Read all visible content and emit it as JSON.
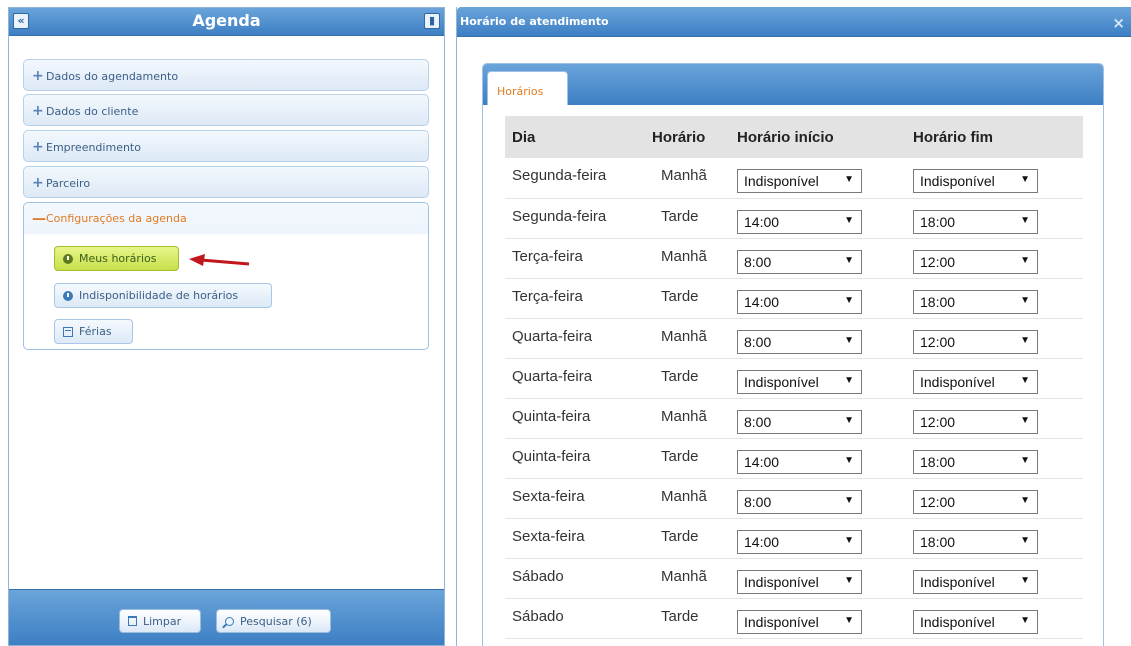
{
  "left": {
    "title": "Agenda",
    "collapse_icon": "«",
    "pin_icon": "▮",
    "accordion": [
      {
        "sign": "+",
        "label": "Dados do agendamento"
      },
      {
        "sign": "+",
        "label": "Dados do cliente"
      },
      {
        "sign": "+",
        "label": "Empreendimento"
      },
      {
        "sign": "+",
        "label": "Parceiro"
      },
      {
        "sign": "—",
        "label": "Configurações da agenda"
      }
    ],
    "sub_buttons": {
      "meus_horarios": "Meus horários",
      "indisponibilidade": "Indisponibilidade de horários",
      "ferias": "Férias"
    },
    "footer": {
      "limpar": "Limpar",
      "pesquisar": "Pesquisar (6)"
    }
  },
  "right": {
    "title": "Horário de atendimento",
    "close_icon": "×",
    "tab": "Horários",
    "columns": [
      "Dia",
      "Horário",
      "Horário início",
      "Horário fim"
    ],
    "rows": [
      {
        "dia": "Segunda-feira",
        "horario": "Manhã",
        "inicio": "Indisponível",
        "fim": "Indisponível"
      },
      {
        "dia": "Segunda-feira",
        "horario": "Tarde",
        "inicio": "14:00",
        "fim": "18:00"
      },
      {
        "dia": "Terça-feira",
        "horario": "Manhã",
        "inicio": "8:00",
        "fim": "12:00"
      },
      {
        "dia": "Terça-feira",
        "horario": "Tarde",
        "inicio": "14:00",
        "fim": "18:00"
      },
      {
        "dia": "Quarta-feira",
        "horario": "Manhã",
        "inicio": "8:00",
        "fim": "12:00"
      },
      {
        "dia": "Quarta-feira",
        "horario": "Tarde",
        "inicio": "Indisponível",
        "fim": "Indisponível"
      },
      {
        "dia": "Quinta-feira",
        "horario": "Manhã",
        "inicio": "8:00",
        "fim": "12:00"
      },
      {
        "dia": "Quinta-feira",
        "horario": "Tarde",
        "inicio": "14:00",
        "fim": "18:00"
      },
      {
        "dia": "Sexta-feira",
        "horario": "Manhã",
        "inicio": "8:00",
        "fim": "12:00"
      },
      {
        "dia": "Sexta-feira",
        "horario": "Tarde",
        "inicio": "14:00",
        "fim": "18:00"
      },
      {
        "dia": "Sábado",
        "horario": "Manhã",
        "inicio": "Indisponível",
        "fim": "Indisponível"
      },
      {
        "dia": "Sábado",
        "horario": "Tarde",
        "inicio": "Indisponível",
        "fim": "Indisponível"
      }
    ]
  },
  "colors": {
    "header_blue": "#3d7fc4",
    "active_orange": "#e07b22",
    "highlight_green": "#c7e04a",
    "arrow_red": "#c0161c"
  }
}
